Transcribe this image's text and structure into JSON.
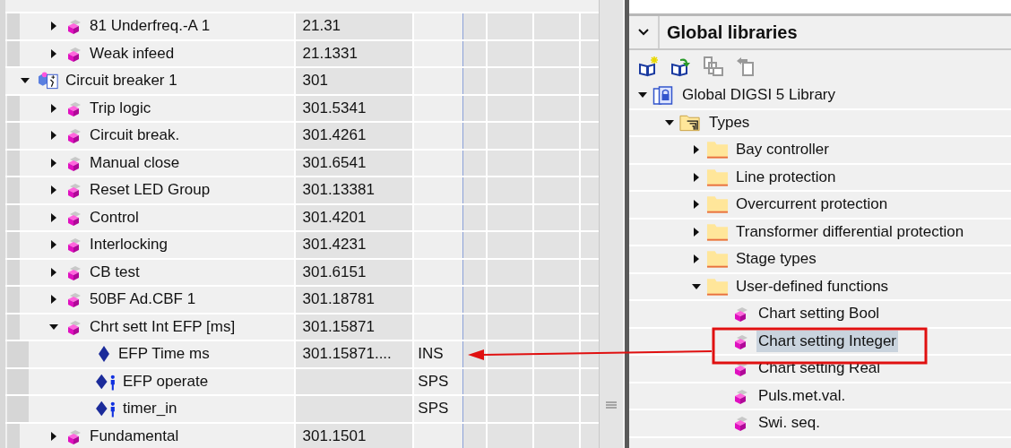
{
  "parameters": {
    "rows": [
      {
        "children": [
          {
            "label": "81 Underfreq.-A 1",
            "kind": "function",
            "address": "21.31",
            "expanded": false
          },
          {
            "label": "Weak infeed",
            "kind": "function",
            "address": "21.1331",
            "expanded": false
          }
        ]
      },
      {
        "label": "Circuit breaker 1",
        "kind": "function_group",
        "address": "301",
        "expanded": true,
        "children": [
          {
            "label": "Trip logic",
            "kind": "function",
            "address": "301.5341",
            "expanded": false
          },
          {
            "label": "Circuit break.",
            "kind": "function",
            "address": "301.4261",
            "expanded": false
          },
          {
            "label": "Manual close",
            "kind": "function",
            "address": "301.6541",
            "expanded": false
          },
          {
            "label": "Reset LED Group",
            "kind": "function",
            "address": "301.13381",
            "expanded": false
          },
          {
            "label": "Control",
            "kind": "function",
            "address": "301.4201",
            "expanded": false
          },
          {
            "label": "Interlocking",
            "kind": "function",
            "address": "301.4231",
            "expanded": false
          },
          {
            "label": "CB test",
            "kind": "function",
            "address": "301.6151",
            "expanded": false
          },
          {
            "label": "50BF Ad.CBF 1",
            "kind": "function",
            "address": "301.18781",
            "expanded": false
          },
          {
            "label": "Chrt sett Int EFP [ms]",
            "kind": "function",
            "address": "301.15871",
            "expanded": true,
            "children": [
              {
                "label": "EFP Time ms",
                "kind": "signal",
                "address": "301.15871....",
                "type": "INS"
              },
              {
                "label": "EFP operate",
                "kind": "signal_io",
                "type": "SPS"
              },
              {
                "label": "timer_in",
                "kind": "signal_io",
                "type": "SPS"
              }
            ]
          },
          {
            "label": "Fundamental",
            "kind": "function",
            "address": "301.1501",
            "expanded": false
          }
        ]
      }
    ]
  },
  "global_libraries": {
    "title": "Global libraries",
    "tree": [
      {
        "label": "Global DIGSI 5 Library",
        "kind": "library",
        "expanded": true,
        "selected": false,
        "children": [
          {
            "label": "Types",
            "kind": "types",
            "expanded": true,
            "selected": false,
            "children": [
              {
                "label": "Bay controller",
                "kind": "folder",
                "expanded": false,
                "selected": false
              },
              {
                "label": "Line protection",
                "kind": "folder",
                "expanded": false,
                "selected": false
              },
              {
                "label": "Overcurrent protection",
                "kind": "folder",
                "expanded": false,
                "selected": false
              },
              {
                "label": "Transformer differential protection",
                "kind": "folder",
                "expanded": false,
                "selected": false
              },
              {
                "label": "Stage types",
                "kind": "folder",
                "expanded": false,
                "selected": false
              },
              {
                "label": "User-defined functions",
                "kind": "folder",
                "expanded": true,
                "selected": false,
                "children": [
                  {
                    "label": "Chart setting Bool",
                    "kind": "function",
                    "selected": false
                  },
                  {
                    "label": "Chart setting Integer",
                    "kind": "function",
                    "selected": true
                  },
                  {
                    "label": "Chart setting Real",
                    "kind": "function",
                    "selected": false
                  },
                  {
                    "label": "Puls.met.val.",
                    "kind": "function",
                    "selected": false
                  },
                  {
                    "label": "Swi. seq.",
                    "kind": "function",
                    "selected": false
                  }
                ]
              }
            ]
          }
        ]
      }
    ]
  }
}
